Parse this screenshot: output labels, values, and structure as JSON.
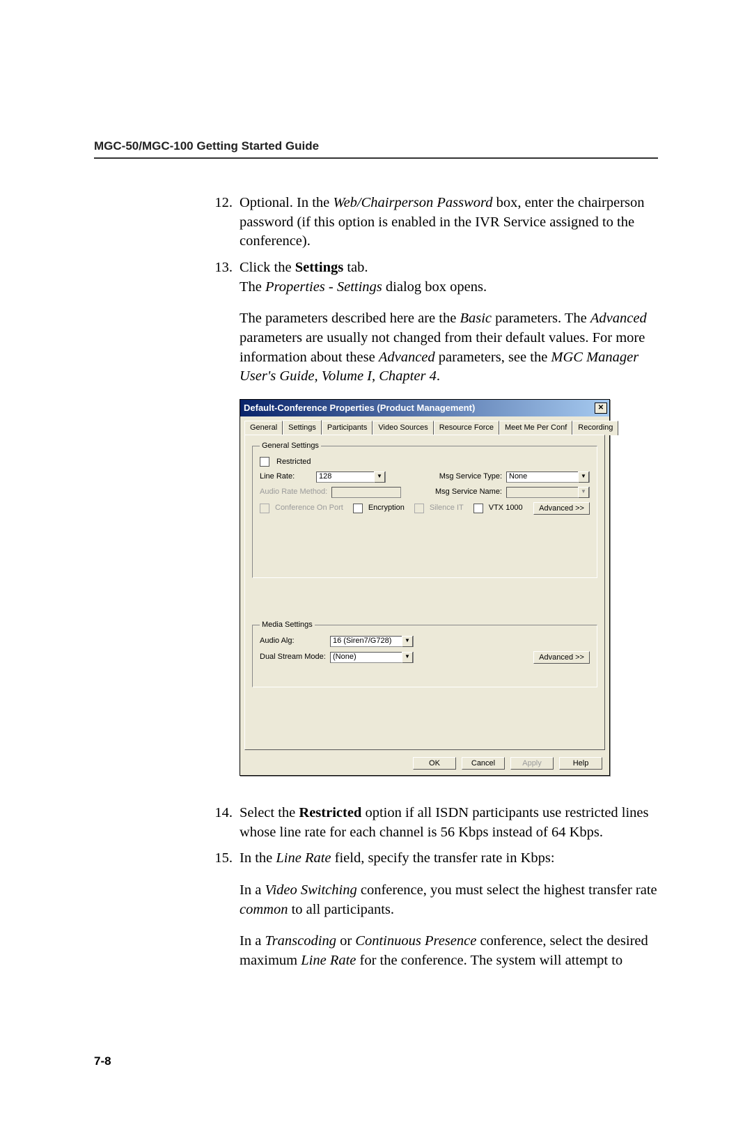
{
  "header": {
    "title": "MGC-50/MGC-100 Getting Started Guide"
  },
  "steps": {
    "s12": {
      "num": "12.",
      "text_prefix": "Optional. In the ",
      "italic1": "Web/Chairperson Password",
      "text_mid": " box, enter the chairperson password (if this option is enabled in the IVR Service assigned to the conference)."
    },
    "s13": {
      "num": "13.",
      "line1_prefix": "Click the ",
      "line1_bold": "Settings",
      "line1_suffix": " tab.",
      "line2_prefix": "The ",
      "line2_italic": "Properties - Settings",
      "line2_suffix": " dialog box opens.",
      "para2_a": "The parameters described here are the ",
      "para2_b_i": "Basic",
      "para2_c": " parameters. The ",
      "para2_d_i": "Advanced",
      "para2_e": " parameters are usually not changed from their default values. For more information about these ",
      "para2_f_i": "Advanced",
      "para2_g": " parameters, see the ",
      "para2_h_i": "MGC Manager User's Guide, Volume I, Chapter 4",
      "para2_i": "."
    },
    "s14": {
      "num": "14.",
      "a": "Select the ",
      "b_bold": "Restricted",
      "c": " option if all ISDN participants use restricted lines whose line rate for each channel is 56 Kbps instead of 64 Kbps."
    },
    "s15": {
      "num": "15.",
      "a": "In the ",
      "b_i": "Line Rate",
      "c": " field, specify the transfer rate in Kbps:",
      "p2_a": "In a ",
      "p2_b_i": "Video Switching",
      "p2_c": " conference, you must select the highest transfer rate ",
      "p2_d_i": "common",
      "p2_e": " to all participants.",
      "p3_a": "In a ",
      "p3_b_i": "Transcoding",
      "p3_c": " or ",
      "p3_d_i": "Continuous Presence",
      "p3_e": " conference, select the desired maximum ",
      "p3_f_i": "Line Rate",
      "p3_g": " for the conference. The system will attempt to"
    }
  },
  "dialog": {
    "title": "Default-Conference Properties  (Product Management)",
    "tabs": [
      "General",
      "Settings",
      "Participants",
      "Video Sources",
      "Resource Force",
      "Meet Me Per Conf",
      "Recording"
    ],
    "active_tab": "Settings",
    "group_general_legend": "General Settings",
    "restricted_label": "Restricted",
    "line_rate_label": "Line Rate:",
    "line_rate_value": "128",
    "audio_rate_method_label": "Audio Rate Method:",
    "msg_service_type_label": "Msg Service Type:",
    "msg_service_type_value": "None",
    "msg_service_name_label": "Msg Service Name:",
    "conference_onport_label": "Conference On Port",
    "encryption_label": "Encryption",
    "silence_it_label": "Silence IT",
    "vtx1000_label": "VTX 1000",
    "advanced_btn": "Advanced >>",
    "group_media_legend": "Media Settings",
    "audio_alg_label": "Audio Alg:",
    "audio_alg_value": "16 (Siren7/G728)",
    "dual_stream_label": "Dual Stream Mode:",
    "dual_stream_value": "(None)",
    "btn_ok": "OK",
    "btn_cancel": "Cancel",
    "btn_apply": "Apply",
    "btn_help": "Help"
  },
  "pagenum": "7-8"
}
